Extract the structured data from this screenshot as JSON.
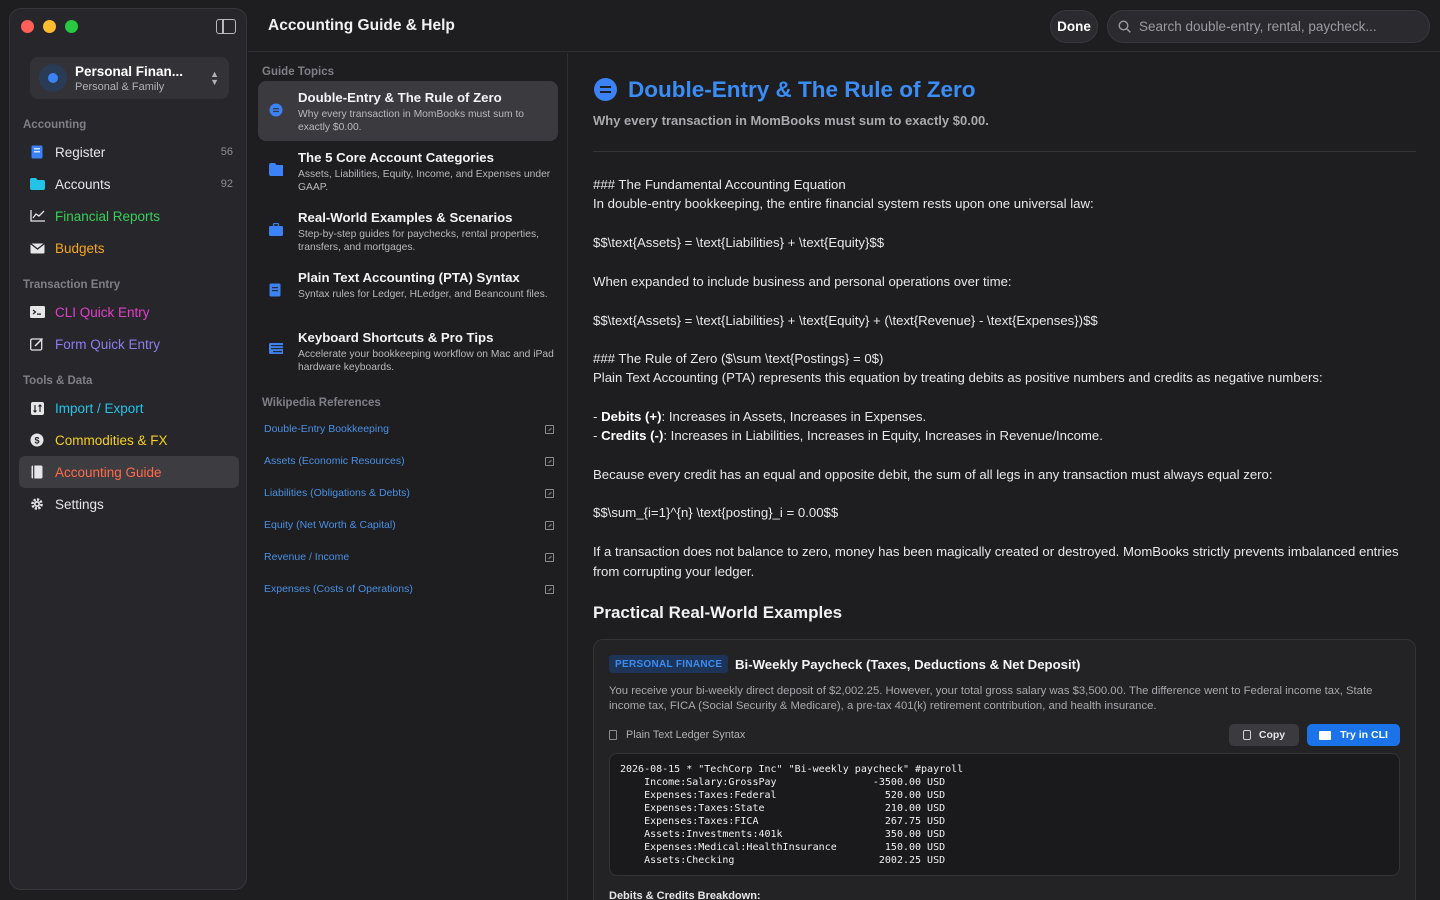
{
  "colors": {
    "red": "#ff5f57",
    "yellow": "#febc2e",
    "green": "#28c840",
    "accent": "#3b8df6"
  },
  "profile": {
    "name": "Personal Finan...",
    "subtitle": "Personal & Family"
  },
  "sidebar": {
    "sections": [
      {
        "title": "Accounting",
        "items": [
          {
            "label": "Register",
            "count": "56",
            "icon": "register-icon",
            "color": "#e6e6e8"
          },
          {
            "label": "Accounts",
            "count": "92",
            "icon": "folder-icon",
            "color": "#e6e6e8"
          },
          {
            "label": "Financial Reports",
            "icon": "chart-icon",
            "color": "#34d058"
          },
          {
            "label": "Budgets",
            "icon": "envelope-icon",
            "color": "#f5a623"
          }
        ]
      },
      {
        "title": "Transaction Entry",
        "items": [
          {
            "label": "CLI Quick Entry",
            "icon": "terminal-icon",
            "color": "#e040c8"
          },
          {
            "label": "Form Quick Entry",
            "icon": "edit-icon",
            "color": "#8c7cf0"
          }
        ]
      },
      {
        "title": "Tools & Data",
        "items": [
          {
            "label": "Import / Export",
            "icon": "import-export-icon",
            "color": "#22c3e6"
          },
          {
            "label": "Commodities & FX",
            "icon": "dollar-icon",
            "color": "#f5d020"
          },
          {
            "label": "Accounting Guide",
            "icon": "book-icon",
            "color": "#ff6b4a",
            "active": true
          },
          {
            "label": "Settings",
            "icon": "gear-icon",
            "color": "#e6e6e8"
          }
        ]
      }
    ]
  },
  "header": {
    "title": "Accounting Guide & Help",
    "done_label": "Done",
    "search_placeholder": "Search double-entry, rental, paycheck..."
  },
  "guide": {
    "topics_title": "Guide Topics",
    "topics": [
      {
        "title": "Double-Entry & The Rule of Zero",
        "desc": "Why every transaction in MomBooks must sum to exactly $0.00.",
        "icon": "equals-icon",
        "active": true
      },
      {
        "title": "The 5 Core Account Categories",
        "desc": "Assets, Liabilities, Equity, Income, and Expenses under GAAP.",
        "icon": "folder-icon"
      },
      {
        "title": "Real-World Examples & Scenarios",
        "desc": "Step-by-step guides for paychecks, rental properties, transfers, and mortgages.",
        "icon": "briefcase-icon"
      },
      {
        "title": "Plain Text Accounting (PTA) Syntax",
        "desc": "Syntax rules for Ledger, HLedger, and Beancount files.",
        "icon": "document-icon"
      },
      {
        "title": "Keyboard Shortcuts & Pro Tips",
        "desc": "Accelerate your bookkeeping workflow on Mac and iPad hardware keyboards.",
        "icon": "keyboard-icon"
      }
    ],
    "refs_title": "Wikipedia References",
    "refs": [
      "Double-Entry Bookkeeping",
      "Assets (Economic Resources)",
      "Liabilities (Obligations & Debts)",
      "Equity (Net Worth & Capital)",
      "Revenue / Income",
      "Expenses (Costs of Operations)"
    ]
  },
  "content": {
    "title": "Double-Entry & The Rule of Zero",
    "subtitle": "Why every transaction in MomBooks must sum to exactly $0.00.",
    "p1_line1": "### The Fundamental Accounting Equation",
    "p1_line2": "In double-entry bookkeeping, the entire financial system rests upon one universal law:",
    "eq1": "$$\\text{Assets} = \\text{Liabilities} + \\text{Equity}$$",
    "p2": "When expanded to include business and personal operations over time:",
    "eq2": "$$\\text{Assets} = \\text{Liabilities} + \\text{Equity} + (\\text{Revenue} - \\text{Expenses})$$",
    "p3_line1": "### The Rule of Zero ($\\sum \\text{Postings} = 0$)",
    "p3_line2": "Plain Text Accounting (PTA) represents this equation by treating debits as positive numbers and credits as negative numbers:",
    "debits_label": "Debits (+)",
    "debits_text": ": Increases in Assets, Increases in Expenses.",
    "credits_label": "Credits (-)",
    "credits_text": ": Increases in Liabilities, Increases in Equity, Increases in Revenue/Income.",
    "p4": "Because every credit has an equal and opposite debit, the sum of all legs in any transaction must always equal zero:",
    "eq3": "$$\\sum_{i=1}^{n} \\text{posting}_i = 0.00$$",
    "p5": "If a transaction does not balance to zero, money has been magically created or destroyed. MomBooks strictly prevents imbalanced entries from corrupting your ledger.",
    "examples_title": "Practical Real-World Examples",
    "example": {
      "badge": "PERSONAL FINANCE",
      "title": "Bi-Weekly Paycheck (Taxes, Deductions & Net Deposit)",
      "desc": "You receive your bi-weekly direct deposit of $2,002.25. However, your total gross salary was $3,500.00. The difference went to Federal income tax, State income tax, FICA (Social Security & Medicare), a pre-tax 401(k) retirement contribution, and health insurance.",
      "ledger_label": "Plain Text Ledger Syntax",
      "copy_label": "Copy",
      "cli_label": "Try in CLI",
      "code": "2026-08-15 * \"TechCorp Inc\" \"Bi-weekly paycheck\" #payroll\n    Income:Salary:GrossPay                -3500.00 USD\n    Expenses:Taxes:Federal                  520.00 USD\n    Expenses:Taxes:State                    210.00 USD\n    Expenses:Taxes:FICA                     267.75 USD\n    Assets:Investments:401k                 350.00 USD\n    Expenses:Medical:HealthInsurance        150.00 USD\n    Assets:Checking                        2002.25 USD",
      "breakdown_title": "Debits & Credits Breakdown:"
    }
  }
}
